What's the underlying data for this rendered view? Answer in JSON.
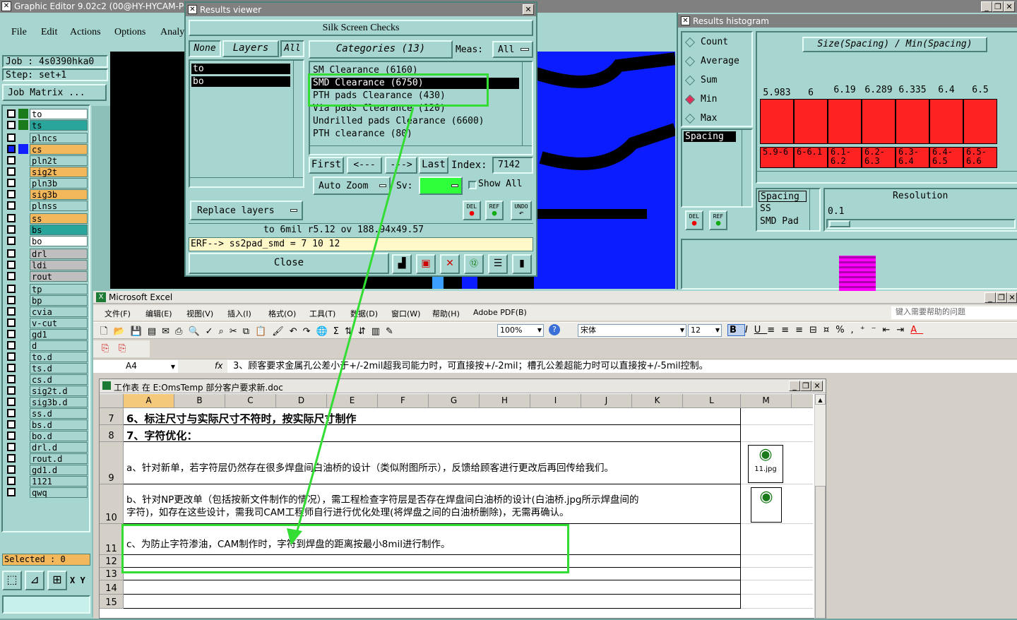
{
  "ge": {
    "title": "Graphic Editor 9.02c2 (00@HY-HYCAM-PC05",
    "menu": [
      "File",
      "Edit",
      "Actions",
      "Options",
      "Analy"
    ],
    "job_label": "Job : 4s0390hka0",
    "step_label": "Step: set+1",
    "job_matrix": "Job Matrix ...",
    "layers": [
      {
        "name": "to",
        "color": "#ffffff"
      },
      {
        "name": "ts",
        "color": "#2aa59c"
      },
      {
        "name": "plncs",
        "color": "#a7d6d0"
      },
      {
        "name": "cs",
        "color": "#f4b85c"
      },
      {
        "name": "pln2t",
        "color": "#a7d6d0"
      },
      {
        "name": "sig2t",
        "color": "#f4b85c"
      },
      {
        "name": "pln3b",
        "color": "#a7d6d0"
      },
      {
        "name": "sig3b",
        "color": "#f4b85c"
      },
      {
        "name": "plnss",
        "color": "#a7d6d0"
      },
      {
        "name": "ss",
        "color": "#f4b85c"
      },
      {
        "name": "bs",
        "color": "#2aa59c"
      },
      {
        "name": "bo",
        "color": "#ffffff"
      },
      {
        "name": "drl",
        "color": "#bfbfbf"
      },
      {
        "name": "ldi",
        "color": "#bfbfbf"
      },
      {
        "name": "rout",
        "color": "#bfbfbf"
      },
      {
        "name": "tp",
        "color": "#a7d6d0"
      },
      {
        "name": "bp",
        "color": "#a7d6d0"
      },
      {
        "name": "cvia",
        "color": "#a7d6d0"
      },
      {
        "name": "v-cut",
        "color": "#a7d6d0"
      },
      {
        "name": "gd1",
        "color": "#a7d6d0"
      },
      {
        "name": "d",
        "color": "#a7d6d0"
      },
      {
        "name": "to.d",
        "color": "#a7d6d0"
      },
      {
        "name": "ts.d",
        "color": "#a7d6d0"
      },
      {
        "name": "cs.d",
        "color": "#a7d6d0"
      },
      {
        "name": "sig2t.d",
        "color": "#a7d6d0"
      },
      {
        "name": "sig3b.d",
        "color": "#a7d6d0"
      },
      {
        "name": "ss.d",
        "color": "#a7d6d0"
      },
      {
        "name": "bs.d",
        "color": "#a7d6d0"
      },
      {
        "name": "bo.d",
        "color": "#a7d6d0"
      },
      {
        "name": "drl.d",
        "color": "#a7d6d0"
      },
      {
        "name": "rout.d",
        "color": "#a7d6d0"
      },
      {
        "name": "gd1.d",
        "color": "#a7d6d0"
      },
      {
        "name": "1121",
        "color": "#a7d6d0"
      },
      {
        "name": "qwq",
        "color": "#a7d6d0"
      }
    ],
    "selected": "Selected : 0",
    "xy": "X Y"
  },
  "results_viewer": {
    "title": "Results viewer",
    "header": "Silk Screen Checks",
    "none_btn": "None",
    "layers_btn": "Layers",
    "all_btn": "All",
    "layer_list": [
      "to",
      "bo"
    ],
    "categories_btn": "Categories (13)",
    "meas_label": "Meas:",
    "meas_value": "All",
    "categories": [
      "SM Clearance (6160)",
      "SMD Clearance (6750)",
      "PTH pads Clearance (430)",
      "Via pads Clearance (120)",
      "Undrilled pads Clearance (6600)",
      "PTH clearance (80)"
    ],
    "first_btn": "First",
    "prev_btn": "<---",
    "next_btn": "--->",
    "last_btn": "Last",
    "index_label": "Index:",
    "index_value": "7142",
    "auto_zoom": "Auto Zoom",
    "sv_label": "Sv:",
    "show_all": "Show All",
    "replace_layers": "Replace layers",
    "del": "DEL",
    "ref": "REF",
    "undo": "UNDO",
    "status_line": "to 6mil r5.12 ov 188.94x49.57",
    "erf_line": "ERF--> ss2pad_smd = 7 10 12",
    "close_btn": "Close"
  },
  "histogram": {
    "title": "Results histogram",
    "options": [
      "Count",
      "Average",
      "Sum",
      "Min",
      "Max"
    ],
    "selected_option": "Min",
    "header": "Size(Spacing) / Min(Spacing)",
    "list_items": [
      "Spacing"
    ],
    "values": [
      "5.983",
      "6",
      "6.19",
      "6.289",
      "6.335",
      "6.4",
      "6.5"
    ],
    "ranges": [
      "5.9-6",
      "6-6.1",
      "6.1-6.2",
      "6.2-6.3",
      "6.3-6.4",
      "6.4-6.5",
      "6.5-6.6"
    ],
    "bar_color": "#ff2222",
    "meas_list": [
      "Spacing",
      "SS",
      "SMD Pad"
    ],
    "resolution_label": "Resolution",
    "resolution_value": "0.1",
    "del": "DEL",
    "ref": "REF"
  },
  "excel": {
    "title": "Microsoft Excel",
    "menu": [
      "文件(F)",
      "编辑(E)",
      "视图(V)",
      "插入(I)",
      "格式(O)",
      "工具(T)",
      "数据(D)",
      "窗口(W)",
      "帮助(H)",
      "Adobe PDF(B)"
    ],
    "help_placeholder": "键入需要帮助的问题",
    "zoom": "100%",
    "font_name": "宋体",
    "font_size": "12",
    "cell_ref": "A4",
    "fx": "fx",
    "formula": "3、顾客要求金属孔公差小于+/-2mil超我司能力时，可直接按+/-2mil；槽孔公差超能力时可以直接按+/-5mil控制。",
    "sheet_title": "工作表 在 E:OmsTemp 部分客户要求新.doc",
    "columns": [
      "A",
      "B",
      "C",
      "D",
      "E",
      "F",
      "G",
      "H",
      "I",
      "J",
      "K",
      "L",
      "M"
    ],
    "rows": [
      {
        "num": "7",
        "text": "6、标注尺寸与实际尺寸不符时，按实际尺寸制作",
        "bold": true
      },
      {
        "num": "8",
        "text": "7、字符优化：",
        "bold": true
      },
      {
        "num": "9",
        "text": "a、针对新单，若字符层仍然存在很多焊盘间白油桥的设计（类似附图所示），反馈给顾客进行更改后再回传给我们。"
      },
      {
        "num": "10",
        "text": "b、针对NP更改单（包括按新文件制作的情况），需工程检查字符层是否存在焊盘间白油桥的设计(白油桥.jpg所示焊盘间的",
        "text2": "字符)，如存在这些设计，需我司CAM工程师自行进行优化处理(将焊盘之间的白油桥删除)，无需再确认。"
      },
      {
        "num": "11",
        "text": "c、为防止字符渗油，CAM制作时，字符到焊盘的距离按最小8mil进行制作。"
      },
      {
        "num": "12",
        "text": ""
      },
      {
        "num": "13",
        "text": ""
      },
      {
        "num": "14",
        "text": ""
      },
      {
        "num": "15",
        "text": ""
      }
    ],
    "attachment_label": "11.jpg",
    "highlight_color": "#33dd33"
  }
}
